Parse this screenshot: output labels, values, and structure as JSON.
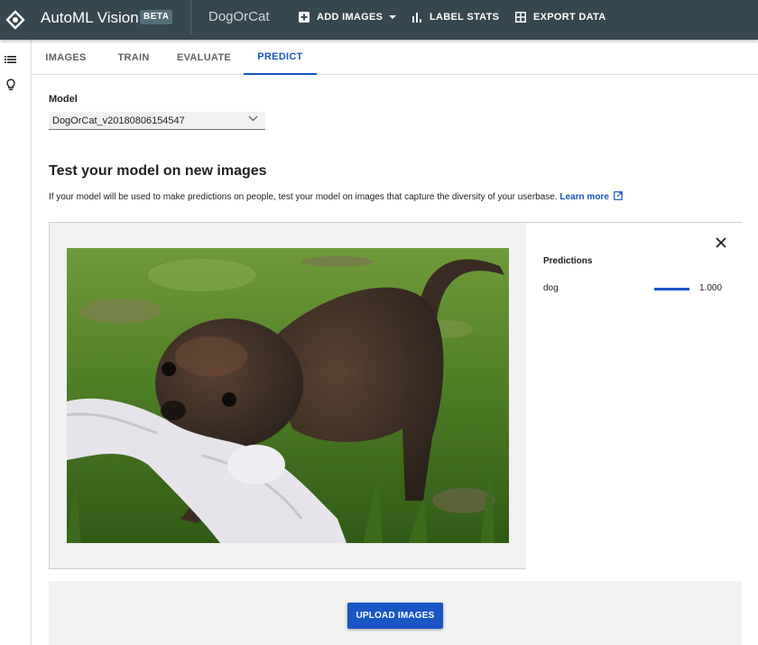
{
  "header": {
    "app_title": "AutoML Vision",
    "badge": "BETA",
    "dataset_name": "DogOrCat",
    "actions": [
      {
        "label": "ADD IMAGES",
        "icon": "add-box-icon",
        "has_dropdown": true
      },
      {
        "label": "LABEL STATS",
        "icon": "bar-chart-icon"
      },
      {
        "label": "EXPORT DATA",
        "icon": "grid-table-icon"
      }
    ],
    "colors": {
      "background": "#37474f",
      "accent": "#1a56c4"
    }
  },
  "rail": {
    "items": [
      {
        "icon": "list-icon"
      },
      {
        "icon": "lightbulb-icon"
      }
    ]
  },
  "tabs": [
    {
      "label": "IMAGES",
      "active": false
    },
    {
      "label": "TRAIN",
      "active": false
    },
    {
      "label": "EVALUATE",
      "active": false
    },
    {
      "label": "PREDICT",
      "active": true
    }
  ],
  "model": {
    "label": "Model",
    "selected": "DogOrCat_v20180806154547"
  },
  "section": {
    "title": "Test your model on new images",
    "description": "If your model will be used to make predictions on people, test your model on images that capture the diversity of your userbase.",
    "learn_more": "Learn more"
  },
  "prediction": {
    "image_alt": "Small dark dog biting a white knotted rope toy on grass",
    "title": "Predictions",
    "results": [
      {
        "label": "dog",
        "score": 1.0,
        "score_text": "1.000"
      }
    ]
  },
  "upload": {
    "button_label": "UPLOAD IMAGES"
  }
}
